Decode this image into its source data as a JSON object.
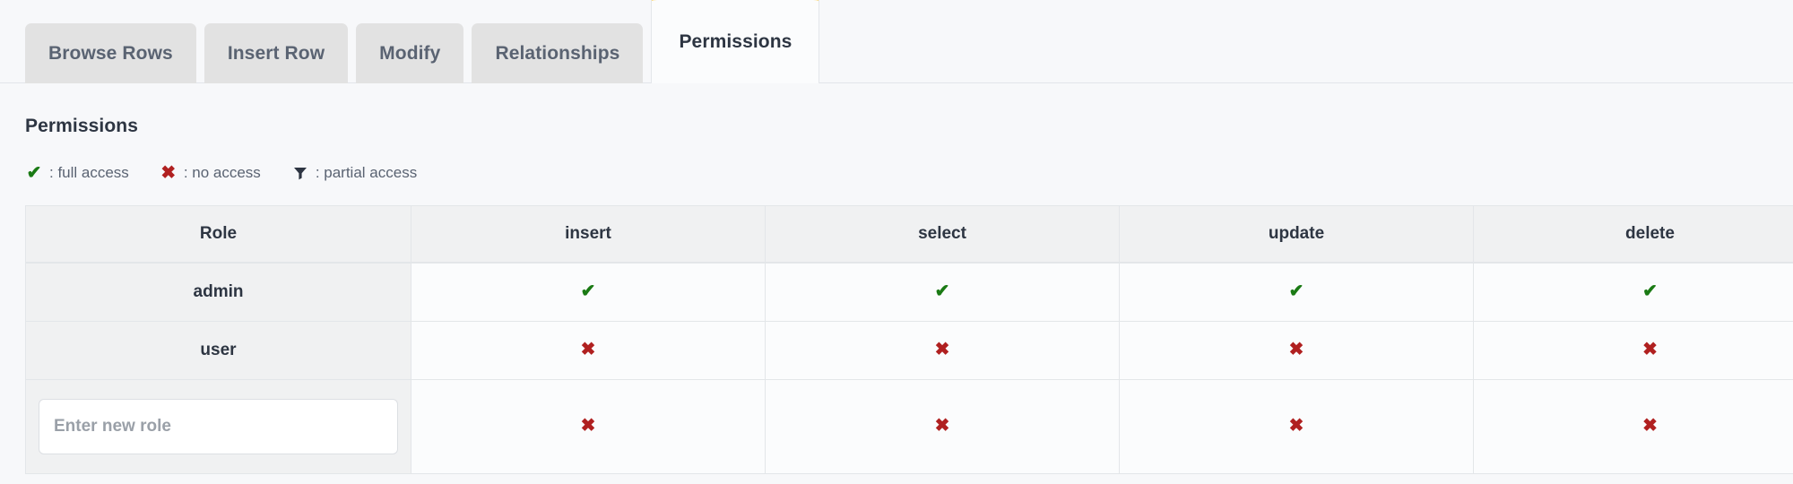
{
  "tabs": [
    {
      "label": "Browse Rows",
      "active": false
    },
    {
      "label": "Insert Row",
      "active": false
    },
    {
      "label": "Modify",
      "active": false
    },
    {
      "label": "Relationships",
      "active": false
    },
    {
      "label": "Permissions",
      "active": true
    }
  ],
  "section": {
    "title": "Permissions"
  },
  "legend": {
    "items": [
      {
        "icon": "check-icon",
        "glyph": "✔",
        "text": ": full access",
        "color": "#1a7a14"
      },
      {
        "icon": "cross-icon",
        "glyph": "✖",
        "text": ": no access",
        "color": "#b02020"
      },
      {
        "icon": "funnel-icon",
        "glyph": "▼",
        "text": ": partial access",
        "color": "#2d3542"
      }
    ]
  },
  "table": {
    "headers": [
      "Role",
      "insert",
      "select",
      "update",
      "delete"
    ],
    "rows": [
      {
        "role": "admin",
        "type": "role",
        "cells": [
          "full",
          "full",
          "full",
          "full"
        ]
      },
      {
        "role": "user",
        "type": "role",
        "cells": [
          "none",
          "none",
          "none",
          "none"
        ]
      },
      {
        "role": "",
        "type": "input",
        "placeholder": "Enter new role",
        "value": "",
        "cells": [
          "none",
          "none",
          "none",
          "none"
        ]
      }
    ],
    "glyphs": {
      "full": "✔",
      "none": "✖",
      "partial": "▼"
    }
  },
  "colors": {
    "accent": "#fdc42b",
    "full_access": "#1a7a14",
    "no_access": "#b02020",
    "page_bg": "#f7f8fa",
    "tab_bg": "#e2e2e2",
    "header_bg": "#f0f1f2"
  }
}
